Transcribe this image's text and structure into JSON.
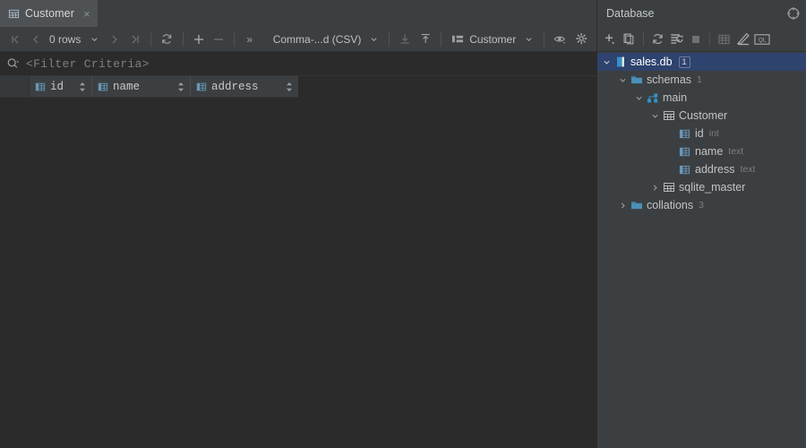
{
  "editor": {
    "tab": {
      "label": "Customer",
      "icon": "table-icon",
      "close": "×"
    },
    "toolbar": {
      "first_page": "first-page-icon",
      "prev_page": "prev-page-icon",
      "rows_label": "0 rows",
      "next_page": "next-page-icon",
      "last_page": "last-page-icon",
      "reload": "reload-icon",
      "add_row": "+",
      "remove_row": "−",
      "overflow": "»",
      "format_label": "Comma-...d (CSV)",
      "import_icon": "import-data-icon",
      "export_icon": "export-data-icon",
      "target_label": "Customer",
      "preview_icon": "eye-icon",
      "settings_icon": "gear-icon"
    },
    "filter": {
      "icon": "search-icon",
      "placeholder": "<Filter Criteria>"
    },
    "grid": {
      "columns": [
        {
          "name": "id",
          "icon": "column-icon"
        },
        {
          "name": "name",
          "icon": "column-icon"
        },
        {
          "name": "address",
          "icon": "column-icon"
        }
      ],
      "rows": []
    }
  },
  "database": {
    "title": "Database",
    "header_icon": "settings-target-icon",
    "toolbar": [
      {
        "name": "new-item-button",
        "icon": "plus-dropdown-icon"
      },
      {
        "name": "duplicate-button",
        "icon": "copy-icon"
      },
      {
        "name": "refresh-button",
        "icon": "refresh-icon"
      },
      {
        "name": "sync-button",
        "icon": "sync-script-icon"
      },
      {
        "name": "stop-button",
        "icon": "stop-square-icon"
      },
      {
        "name": "data-editor-button",
        "icon": "table-grid-icon"
      },
      {
        "name": "modify-button",
        "icon": "pencil-icon"
      },
      {
        "name": "query-console-button",
        "icon": "ql-console-icon"
      }
    ],
    "tree": [
      {
        "label": "sales.db",
        "icon": "db-file-icon",
        "indent": 0,
        "expanded": true,
        "selected": true,
        "badge": "1",
        "sub": ""
      },
      {
        "label": "schemas",
        "icon": "folder-icon",
        "indent": 1,
        "expanded": true,
        "selected": false,
        "badge": "",
        "sub": "1"
      },
      {
        "label": "main",
        "icon": "schema-icon",
        "indent": 2,
        "expanded": true,
        "selected": false,
        "badge": "",
        "sub": ""
      },
      {
        "label": "Customer",
        "icon": "table-icon",
        "indent": 3,
        "expanded": true,
        "selected": false,
        "badge": "",
        "sub": ""
      },
      {
        "label": "id",
        "icon": "column-icon",
        "indent": 4,
        "expanded": null,
        "selected": false,
        "badge": "",
        "sub": "int"
      },
      {
        "label": "name",
        "icon": "column-icon",
        "indent": 4,
        "expanded": null,
        "selected": false,
        "badge": "",
        "sub": "text"
      },
      {
        "label": "address",
        "icon": "column-icon",
        "indent": 4,
        "expanded": null,
        "selected": false,
        "badge": "",
        "sub": "text"
      },
      {
        "label": "sqlite_master",
        "icon": "table-icon",
        "indent": 3,
        "expanded": false,
        "selected": false,
        "badge": "",
        "sub": ""
      },
      {
        "label": "collations",
        "icon": "folder-icon",
        "indent": 1,
        "expanded": false,
        "selected": false,
        "badge": "",
        "sub": "3"
      }
    ]
  },
  "colors": {
    "editor_bg": "#2b2b2b",
    "panel_bg": "#3c3f41",
    "tab_active_bg": "#4e5254",
    "selection_bg": "#2e436e",
    "accent_blue": "#3592c4",
    "text": "#bbbbbb",
    "muted_text": "#7b7f81"
  }
}
